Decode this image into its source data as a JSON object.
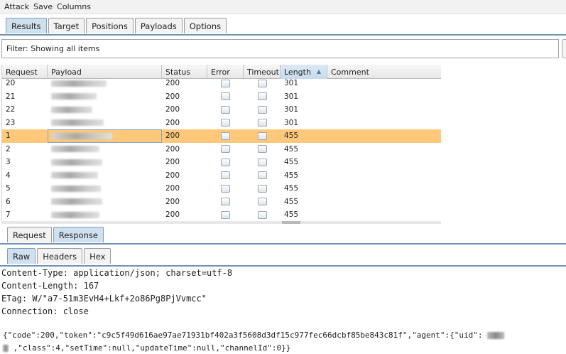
{
  "menu": [
    "Attack",
    "Save",
    "Columns"
  ],
  "main_tabs": [
    "Results",
    "Target",
    "Positions",
    "Payloads",
    "Options"
  ],
  "filter_text": "Filter: Showing all items",
  "table": {
    "columns": [
      "Request",
      "Payload",
      "Status",
      "Error",
      "Timeout",
      "Length",
      "Comment"
    ],
    "sorted_column": "Length",
    "rows": [
      {
        "request": "20",
        "status": "200",
        "length": "301"
      },
      {
        "request": "21",
        "status": "200",
        "length": "301"
      },
      {
        "request": "22",
        "status": "200",
        "length": "301"
      },
      {
        "request": "23",
        "status": "200",
        "length": "301"
      },
      {
        "request": "1",
        "status": "200",
        "length": "455"
      },
      {
        "request": "2",
        "status": "200",
        "length": "455"
      },
      {
        "request": "3",
        "status": "200",
        "length": "455"
      },
      {
        "request": "4",
        "status": "200",
        "length": "455"
      },
      {
        "request": "5",
        "status": "200",
        "length": "455"
      },
      {
        "request": "6",
        "status": "200",
        "length": "455"
      },
      {
        "request": "7",
        "status": "200",
        "length": "455"
      }
    ],
    "selected_request": "1"
  },
  "message_tabs": [
    "Request",
    "Response"
  ],
  "view_tabs": [
    "Raw",
    "Headers",
    "Hex"
  ],
  "response": {
    "headers": [
      "Content-Type: application/json; charset=utf-8",
      "Content-Length: 167",
      "ETag: W/\"a7-51m3EvH4+Lkf+2o86Pg8PjVvmcc\"",
      "Connection: close"
    ],
    "body_line1": "{\"code\":200,\"token\":\"c9c5f49d616ae97ae71931bf402a3f5608d3df15c977fec66dcbf85be843c81f\",\"agent\":{\"uid\":",
    "body_line2": ",\"class\":4,\"setTime\":null,\"updateTime\":null,\"channelId\":0}}"
  },
  "colors": {
    "selected_row": "#ffc87a",
    "active_tab": "#cfe0ee",
    "tab_underline": "#6f93b8"
  }
}
